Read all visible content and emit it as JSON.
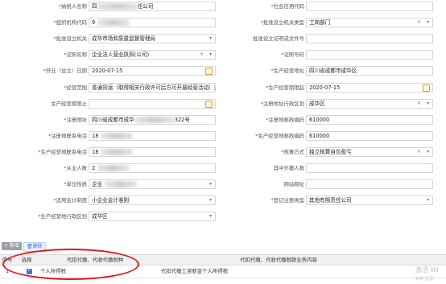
{
  "form": {
    "rows": [
      {
        "l_label": "纳税人名称",
        "l_req": true,
        "l_value": "四",
        "l_blur_tail": "任公司",
        "r_label": "社会信用代码",
        "r_req": true,
        "r_value": ""
      },
      {
        "l_label": "组织机构代码",
        "l_req": true,
        "l_value": "9",
        "r_label": "批准设立机关类型",
        "r_req": true,
        "r_value": "工商部门",
        "r_clear": "×",
        "r_caret": "▾"
      },
      {
        "l_label": "批准设立机关",
        "l_req": true,
        "l_value": "成华市场和质量监督管理局",
        "l_caret": "▾",
        "r_label": "批准设立证明或文件号",
        "r_req": false,
        "r_value": ""
      },
      {
        "l_label": "证照名称",
        "l_req": true,
        "l_value": "企业法人营业执照(公司)",
        "l_clear": "×",
        "l_caret": "▾",
        "r_label": "证照号码",
        "r_req": true,
        "r_value": ""
      },
      {
        "l_label": "开业（设立）日期",
        "l_req": true,
        "l_value": "2020-07-15",
        "l_cal": true,
        "r_label": "生产经营地址",
        "r_req": true,
        "r_value": "四川省成都市成华区"
      },
      {
        "l_label": "经营范围",
        "l_req": true,
        "l_value": "普通货运（取得相关行政许可后方可开展经营活动）;",
        "r_label": "生产经营期限起",
        "r_req": true,
        "r_value": "2020-07-15",
        "r_cal": true
      },
      {
        "l_label": "生产经营期限止",
        "l_req": false,
        "l_value": "",
        "l_cal": true,
        "r_label": "注册地址行政区划",
        "r_req": true,
        "r_value": "成华区",
        "r_clear": "×",
        "r_caret": "▾"
      },
      {
        "l_label": "注册地址",
        "l_req": true,
        "l_value": "四川省成都市成华",
        "l_blur_tail": "322号",
        "r_label": "注册地邮政编码",
        "r_req": true,
        "r_value": "610000"
      },
      {
        "l_label": "注册地联系电话",
        "l_req": true,
        "l_value": "18",
        "r_label": "生产经营地邮政编码",
        "r_req": true,
        "r_value": "610000"
      },
      {
        "l_label": "生产经营地联系电话",
        "l_req": true,
        "l_value": "18",
        "r_label": "核算方式",
        "r_req": true,
        "r_value": "独立核算自负盈亏",
        "r_clear": "×",
        "r_caret": "▾"
      },
      {
        "l_label": "从业人数",
        "l_req": true,
        "l_value": "2",
        "r_label": "其中外籍人数",
        "r_req": false,
        "r_value": ""
      },
      {
        "l_label": "单位性质",
        "l_req": true,
        "l_value": "企业",
        "l_caret": "▾",
        "r_label": "网站网址",
        "r_req": false,
        "r_value": ""
      },
      {
        "l_label": "适用会计制度",
        "l_req": true,
        "l_value": "小企业会计准则",
        "l_caret": "▾",
        "r_label": "登记注册类型",
        "r_req": true,
        "r_value": "其他有限责任公司",
        "r_caret": "▾"
      },
      {
        "l_label": "生产经营地行政区划",
        "l_req": true,
        "l_value": "成华区",
        "l_caret": "▾",
        "r_label": null,
        "r_req": false,
        "r_value": null
      }
    ]
  },
  "toolbar": {
    "add_label": "+ 新增",
    "delete_label": "删除"
  },
  "grid": {
    "headers": [
      "序号",
      "选择",
      "代扣代缴、代收代缴税种",
      "代扣代缴、代收代缴税款业务内容"
    ],
    "rows": [
      {
        "index": "1",
        "checked": true,
        "tax_type": "个人所得税",
        "business": "代扣代缴工资薪金个人所得税"
      }
    ]
  },
  "watermark": {
    "line1": "激活 Wi",
    "line2": "转到\"设置\""
  },
  "colors": {
    "required": "#e4393c",
    "accent": "#2f7de1",
    "annotation": "#e3161b"
  }
}
